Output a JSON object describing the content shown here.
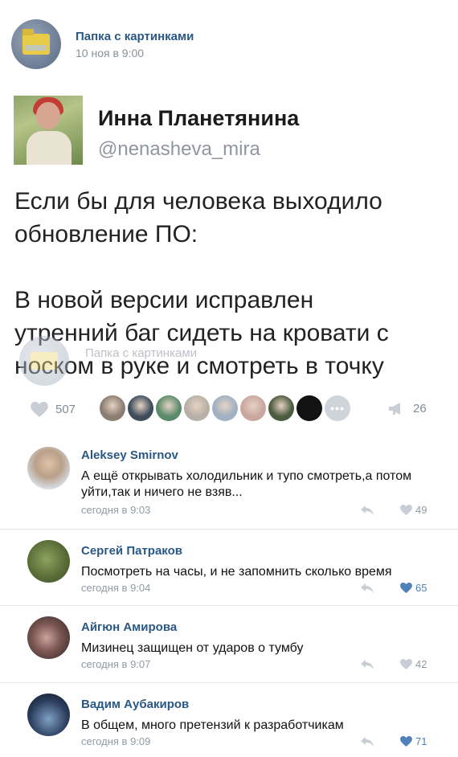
{
  "post": {
    "group_name": "Папка с картинками",
    "date": "10 ноя в 9:00"
  },
  "tweet": {
    "author_name": "Инна Планетянина",
    "handle": "@nenasheva_mira",
    "text": "Если бы для человека выходило\nобновление ПО:\n\nВ новой версии исправлен\nутренний баг сидеть на кровати с\nноском в руке и смотреть в точку",
    "watermark": "Папка с картинками"
  },
  "stats": {
    "likes": "507",
    "reposts": "26",
    "more_indicator": "•••",
    "sharer_colors": [
      "#8a7d72",
      "#3e4c5c",
      "#5a8a6a",
      "#b7b0a6",
      "#9fb1c2",
      "#c9a6a0",
      "#4c5a3e",
      "#121212"
    ]
  },
  "comments": [
    {
      "author": "Aleksey Smirnov",
      "text": "А ещё открывать холодильник и тупо смотреть,а потом уйти,так и ничего не взяв...",
      "date": "сегодня в 9:03",
      "likes": "49",
      "liked": false
    },
    {
      "author": "Сергей Патраков",
      "text": "Посмотреть на часы, и не запомнить сколько время",
      "date": "сегодня в 9:04",
      "likes": "65",
      "liked": true
    },
    {
      "author": "Айгюн Амирова",
      "text": "Мизинец защищен от ударов о тумбу",
      "date": "сегодня в 9:07",
      "likes": "42",
      "liked": false
    },
    {
      "author": "Вадим Аубакиров",
      "text": "В общем, много претензий к разработчикам",
      "date": "сегодня в 9:09",
      "likes": "71",
      "liked": true
    }
  ],
  "colors": {
    "link": "#2a5885",
    "liked": "#5181b8",
    "muted": "#828a99"
  }
}
